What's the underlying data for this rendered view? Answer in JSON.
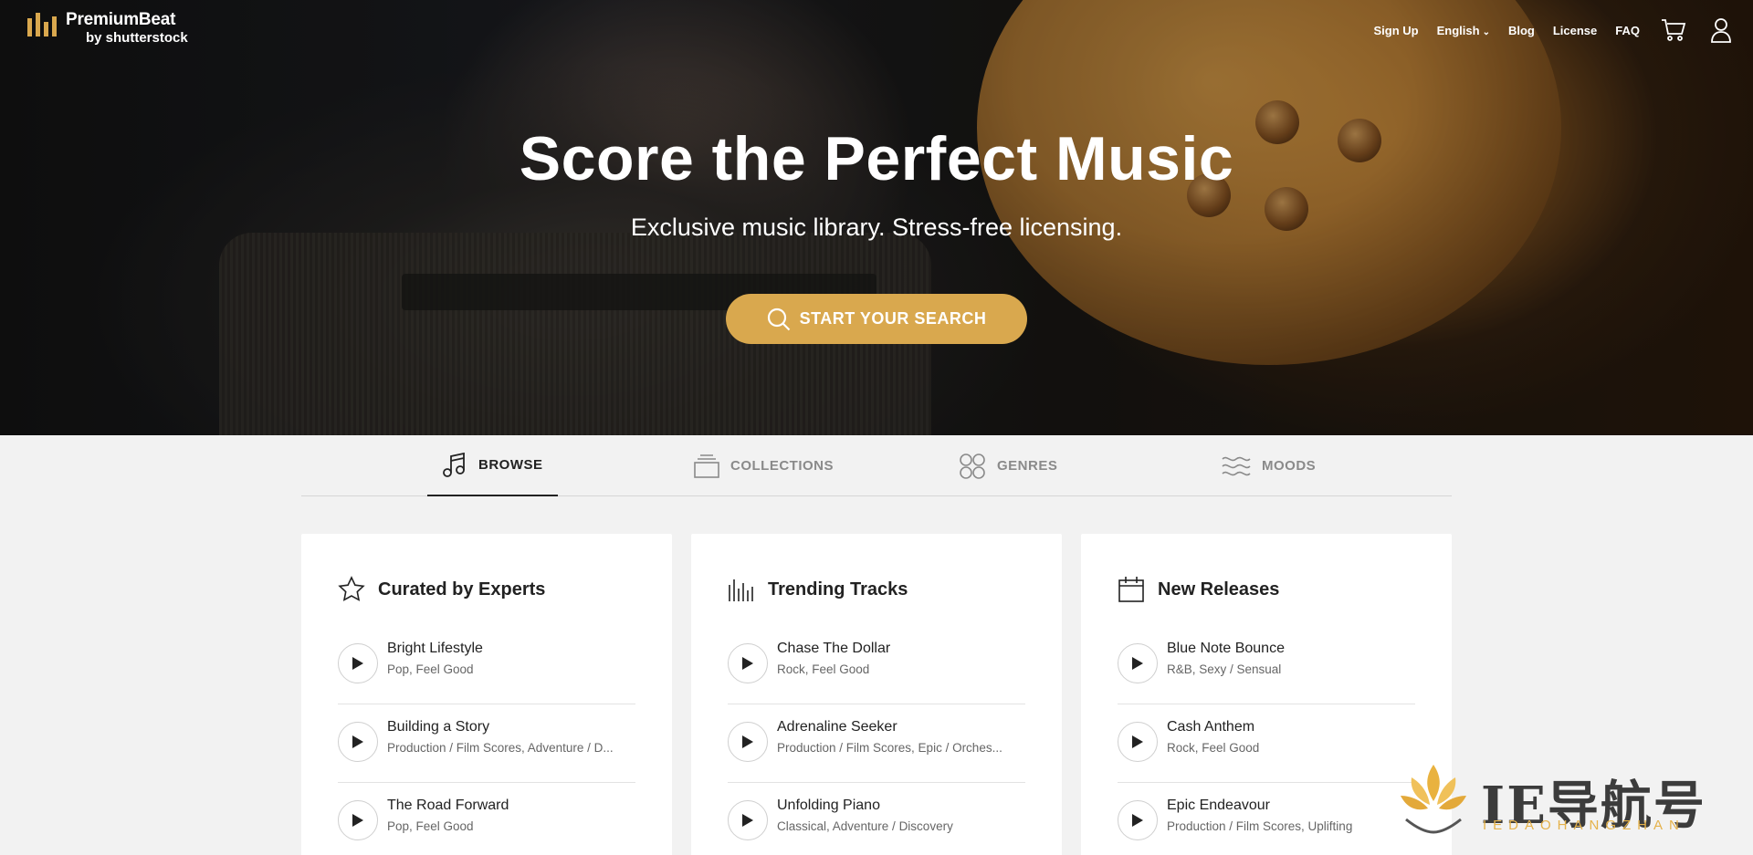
{
  "brand": {
    "name": "PremiumBeat",
    "sub": "by shutterstock",
    "accent_color": "#d9a84e"
  },
  "nav": {
    "signup": "Sign Up",
    "language": "English",
    "blog": "Blog",
    "license": "License",
    "faq": "FAQ",
    "cart_icon": "cart-icon",
    "account_icon": "user-icon"
  },
  "hero": {
    "title": "Score the Perfect Music",
    "subtitle": "Exclusive music library. Stress-free licensing.",
    "search_label": "START YOUR SEARCH"
  },
  "tabs": [
    {
      "label": "BROWSE",
      "icon": "music-note-icon",
      "active": true
    },
    {
      "label": "COLLECTIONS",
      "icon": "collections-icon",
      "active": false
    },
    {
      "label": "GENRES",
      "icon": "genres-icon",
      "active": false
    },
    {
      "label": "MOODS",
      "icon": "moods-icon",
      "active": false
    }
  ],
  "cards": [
    {
      "title": "Curated by Experts",
      "icon": "star-icon",
      "tracks": [
        {
          "name": "Bright Lifestyle",
          "tags": "Pop, Feel Good"
        },
        {
          "name": "Building a Story",
          "tags": "Production / Film Scores, Adventure / D..."
        },
        {
          "name": "The Road Forward",
          "tags": "Pop, Feel Good"
        }
      ]
    },
    {
      "title": "Trending Tracks",
      "icon": "bars-icon",
      "tracks": [
        {
          "name": "Chase The Dollar",
          "tags": "Rock, Feel Good"
        },
        {
          "name": "Adrenaline Seeker",
          "tags": "Production / Film Scores, Epic / Orches..."
        },
        {
          "name": "Unfolding Piano",
          "tags": "Classical, Adventure / Discovery"
        }
      ]
    },
    {
      "title": "New Releases",
      "icon": "calendar-icon",
      "tracks": [
        {
          "name": "Blue Note Bounce",
          "tags": "R&B, Sexy / Sensual"
        },
        {
          "name": "Cash Anthem",
          "tags": "Rock, Feel Good"
        },
        {
          "name": "Epic Endeavour",
          "tags": "Production / Film Scores, Uplifting"
        }
      ]
    }
  ],
  "watermark": {
    "text": "IE导航号",
    "sub": "IEDAOHANGZHAN"
  }
}
